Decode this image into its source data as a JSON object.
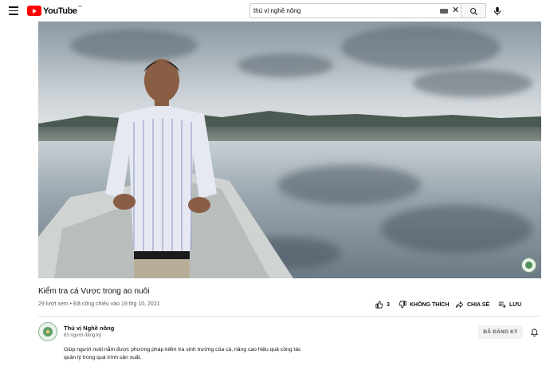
{
  "header": {
    "logo_text": "YouTube",
    "logo_country": "VN",
    "search_value": "thú vị nghề nông",
    "icons": [
      "menu-icon",
      "youtube-logo-icon",
      "keyboard-icon",
      "clear-icon",
      "search-icon",
      "mic-icon"
    ]
  },
  "video": {
    "title": "Kiểm tra cá Vược trong ao nuôi",
    "meta": "29 lượt xem • Đã công chiếu vào 19 thg 10, 2021"
  },
  "actions": {
    "like_count": "3",
    "dislike_label": "KHÔNG THÍCH",
    "share_label": "CHIA SẺ",
    "save_label": "LƯU"
  },
  "channel": {
    "name": "Thú vị Nghề nông",
    "subscribers": "63 người đăng ký",
    "subscribed_label": "ĐÃ ĐĂNG KÝ"
  },
  "description": {
    "line1": "Giúp người nuôi nắm được phương pháp kiểm tra sinh trưởng của cá, nâng cao hiệu quả công tác",
    "line2": "quản lý trong quá trình sản xuất."
  },
  "colors": {
    "brand_red": "#ff0000",
    "text": "#0f0f0f",
    "muted": "#606060"
  }
}
